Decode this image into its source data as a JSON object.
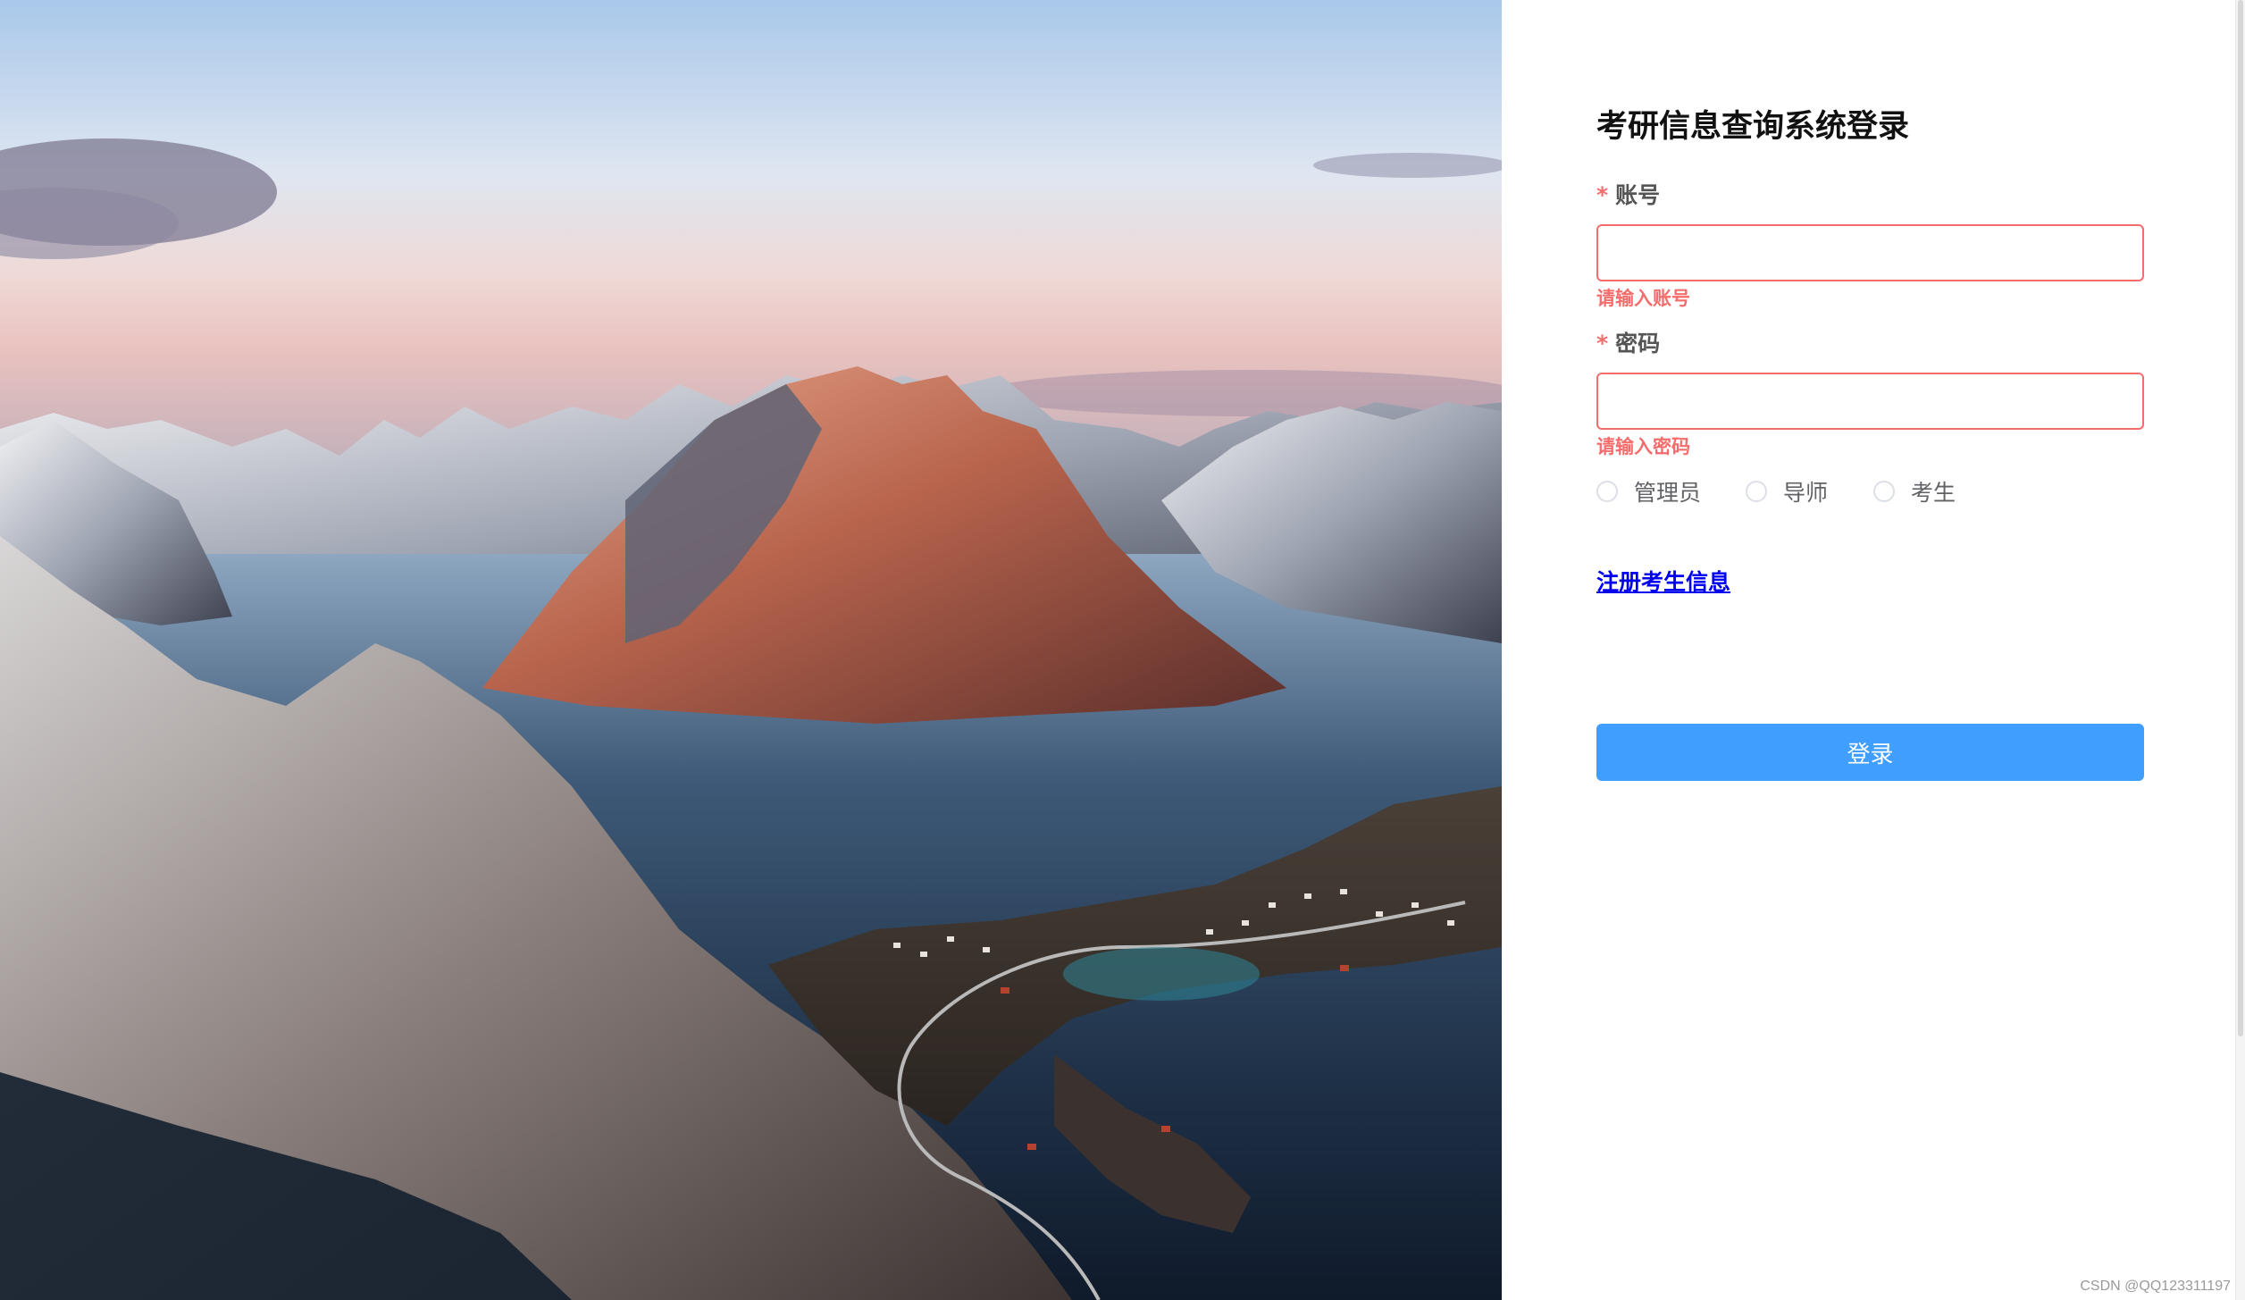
{
  "login": {
    "title": "考研信息查询系统登录",
    "account": {
      "label": "账号",
      "required_mark": "*",
      "value": "",
      "error": "请输入账号"
    },
    "password": {
      "label": "密码",
      "required_mark": "*",
      "value": "",
      "error": "请输入密码"
    },
    "roles": [
      {
        "label": "管理员",
        "selected": false
      },
      {
        "label": "导师",
        "selected": false
      },
      {
        "label": "考生",
        "selected": false
      }
    ],
    "register_link": "注册考生信息",
    "submit_label": "登录"
  },
  "watermark": "CSDN @QQ123311197",
  "colors": {
    "error": "#f56c6c",
    "primary": "#409eff",
    "link": "#0000ee"
  }
}
